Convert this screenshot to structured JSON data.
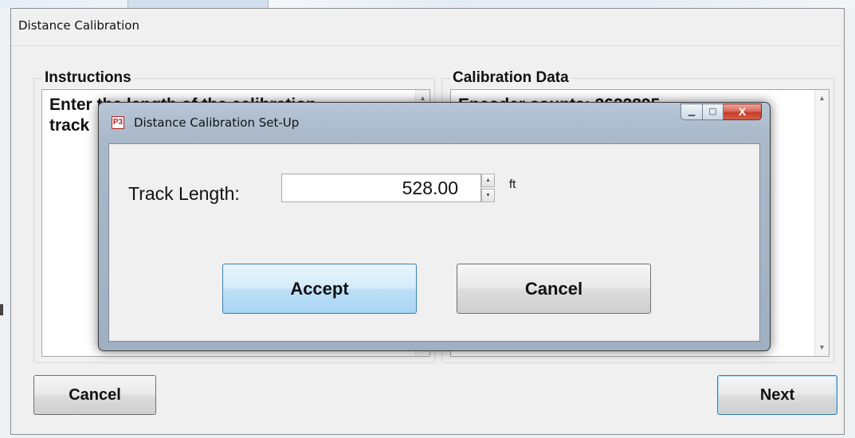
{
  "main_window": {
    "title": "Distance Calibration",
    "instructions": {
      "legend": "Instructions",
      "text_line1": "Enter the length of the calibration",
      "text_line2": "track"
    },
    "calibration_data": {
      "legend": "Calibration Data",
      "text": "Encoder counts: 2622895"
    },
    "buttons": {
      "cancel": "Cancel",
      "next": "Next"
    }
  },
  "dialog": {
    "icon_text": "P3",
    "title": "Distance Calibration Set-Up",
    "caption": {
      "minimize": "▁",
      "maximize": "▢",
      "close": "X"
    },
    "track_length_label": "Track Length:",
    "track_length_value": "528.00",
    "unit": "ft",
    "buttons": {
      "accept": "Accept",
      "cancel": "Cancel"
    }
  },
  "icons": {
    "scroll_up": "▲",
    "scroll_down": "▼",
    "spin_up": "▲",
    "spin_down": "▼"
  }
}
